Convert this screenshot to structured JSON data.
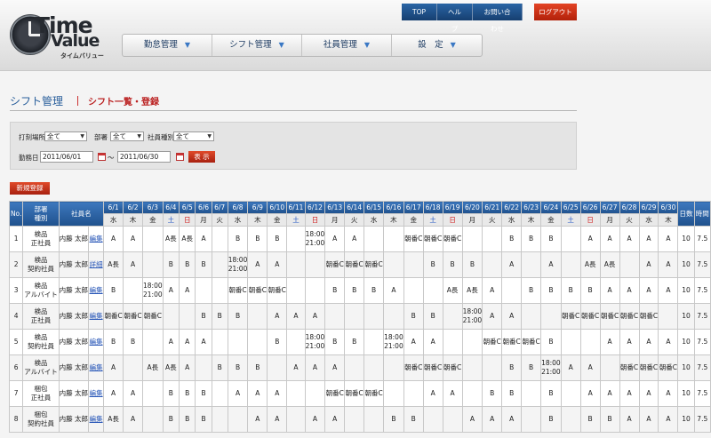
{
  "header": {
    "logo": {
      "line1": "Time",
      "line2": "Value",
      "sub": "タイムバリュー"
    },
    "topnav": [
      "TOP",
      "ヘルプ",
      "お問い合わせ"
    ],
    "logout": "ログアウト",
    "mainnav": [
      {
        "label": "勤怠管理"
      },
      {
        "label": "シフト管理"
      },
      {
        "label": "社員管理"
      },
      {
        "label": "設　定"
      }
    ]
  },
  "page": {
    "title": "シフト管理",
    "subtitle": "シフト一覧・登録"
  },
  "search": {
    "location_label": "打刻場所",
    "location_value": "全て",
    "dept_label": "部署",
    "dept_value": "全て",
    "type_label": "社員種別",
    "type_value": "全て",
    "date_label": "勤務日",
    "date_from": "2011/06/01",
    "date_sep": "～",
    "date_to": "2011/06/30",
    "show_button": "表 示"
  },
  "new_button": "新規登録",
  "table": {
    "col_no": "No.",
    "col_dept": "部署\n種別",
    "col_name": "社員名",
    "col_days": "日数",
    "col_hours": "時間",
    "dates": [
      "6/1",
      "6/2",
      "6/3",
      "6/4",
      "6/5",
      "6/6",
      "6/7",
      "6/8",
      "6/9",
      "6/10",
      "6/11",
      "6/12",
      "6/13",
      "6/14",
      "6/15",
      "6/16",
      "6/17",
      "6/18",
      "6/19",
      "6/20",
      "6/21",
      "6/22",
      "6/23",
      "6/24",
      "6/25",
      "6/26",
      "6/27",
      "6/28",
      "6/29",
      "6/30"
    ],
    "weekdays": [
      "水",
      "木",
      "金",
      "土",
      "日",
      "月",
      "火",
      "水",
      "木",
      "金",
      "土",
      "日",
      "月",
      "火",
      "水",
      "木",
      "金",
      "土",
      "日",
      "月",
      "火",
      "水",
      "木",
      "金",
      "土",
      "日",
      "月",
      "火",
      "水",
      "木"
    ],
    "rows": [
      {
        "no": "1",
        "dept": "検品",
        "type": "正社員",
        "name": "内藤 太郎",
        "link": "編集",
        "shifts": [
          "A",
          "A",
          "",
          "A長",
          "A長",
          "A",
          "",
          "B",
          "B",
          "B",
          "",
          "18:00\n21:00",
          "A",
          "A",
          "",
          "",
          "朝番C",
          "朝番C",
          "朝番C",
          "",
          "",
          "B",
          "B",
          "B",
          "",
          "A",
          "A",
          "A",
          "A",
          "A"
        ],
        "days": "10",
        "hours": "7.5"
      },
      {
        "no": "2",
        "dept": "検品",
        "type": "契約社員",
        "name": "内藤 太郎",
        "link": "詳細",
        "shifts": [
          "A長",
          "A",
          "",
          "B",
          "B",
          "B",
          "",
          "18:00\n21:00",
          "A",
          "A",
          "",
          "",
          "朝番C",
          "朝番C",
          "朝番C",
          "",
          "",
          "B",
          "B",
          "B",
          "",
          "A",
          "",
          "A",
          "",
          "A長",
          "A長",
          "",
          "A",
          "A"
        ],
        "days": "10",
        "hours": "7.5"
      },
      {
        "no": "3",
        "dept": "検品",
        "type": "アルバイト",
        "name": "内藤 太郎",
        "link": "編集",
        "shifts": [
          "B",
          "",
          "18:00\n21:00",
          "A",
          "A",
          "",
          "",
          "朝番C",
          "朝番C",
          "朝番C",
          "",
          "",
          "B",
          "B",
          "B",
          "A",
          "",
          "",
          "A長",
          "A長",
          "A",
          "",
          "B",
          "B",
          "B",
          "B",
          "A",
          "A",
          "A",
          "A"
        ],
        "days": "10",
        "hours": "7.5"
      },
      {
        "no": "4",
        "dept": "検品",
        "type": "正社員",
        "name": "内藤 太郎",
        "link": "編集",
        "shifts": [
          "朝番C",
          "朝番C",
          "朝番C",
          "",
          "",
          "B",
          "B",
          "B",
          "",
          "A",
          "A",
          "A",
          "",
          "",
          "",
          "",
          "B",
          "B",
          "",
          "18:00\n21:00",
          "A",
          "A",
          "",
          "",
          "朝番C",
          "朝番C",
          "朝番C",
          "朝番C",
          "朝番C",
          ""
        ],
        "days": "10",
        "hours": "7.5"
      },
      {
        "no": "5",
        "dept": "検品",
        "type": "契約社員",
        "name": "内藤 太郎",
        "link": "編集",
        "shifts": [
          "B",
          "B",
          "",
          "A",
          "A",
          "A",
          "",
          "",
          "",
          "B",
          "",
          "18:00\n21:00",
          "B",
          "B",
          "",
          "18:00\n21:00",
          "A",
          "A",
          "",
          "",
          "朝番C",
          "朝番C",
          "朝番C",
          "B",
          "",
          "",
          "A",
          "A",
          "A",
          "A"
        ],
        "days": "10",
        "hours": "7.5"
      },
      {
        "no": "6",
        "dept": "検品",
        "type": "アルバイト",
        "name": "内藤 太郎",
        "link": "編集",
        "shifts": [
          "A",
          "",
          "A長",
          "A長",
          "A",
          "",
          "B",
          "B",
          "B",
          "",
          "A",
          "A",
          "A",
          "",
          "",
          "",
          "朝番C",
          "朝番C",
          "朝番C",
          "",
          "",
          "B",
          "B",
          "18:00\n21:00",
          "A",
          "A",
          "",
          "朝番C",
          "朝番C",
          "朝番C"
        ],
        "days": "10",
        "hours": "7.5"
      },
      {
        "no": "7",
        "dept": "梱包",
        "type": "正社員",
        "name": "内藤 太郎",
        "link": "編集",
        "shifts": [
          "A",
          "A",
          "",
          "B",
          "B",
          "B",
          "",
          "A",
          "A",
          "A",
          "",
          "",
          "朝番C",
          "朝番C",
          "朝番C",
          "",
          "",
          "A",
          "A",
          "",
          "B",
          "B",
          "",
          "B",
          "",
          "A",
          "A",
          "A",
          "A",
          "A"
        ],
        "days": "10",
        "hours": "7.5"
      },
      {
        "no": "8",
        "dept": "梱包",
        "type": "契約社員",
        "name": "内藤 太郎",
        "link": "編集",
        "shifts": [
          "A長",
          "A",
          "",
          "B",
          "B",
          "B",
          "",
          "",
          "A",
          "A",
          "",
          "A",
          "A",
          "",
          "",
          "B",
          "B",
          "",
          "",
          "A",
          "A",
          "A",
          "",
          "B",
          "",
          "B",
          "B",
          "A",
          "A",
          "A"
        ],
        "days": "10",
        "hours": "7.5"
      }
    ]
  }
}
